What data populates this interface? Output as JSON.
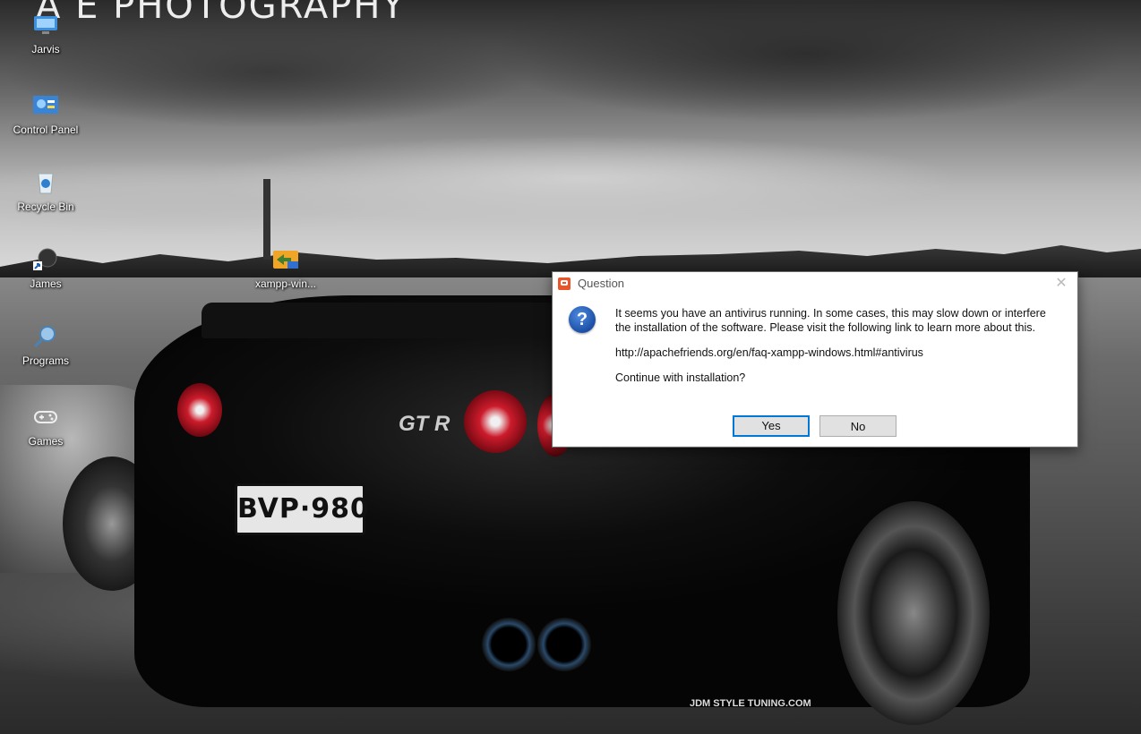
{
  "wallpaper": {
    "brand_text": "A E PHOTOGRAPHY",
    "plate_text": "BVP·980",
    "badge_text": "GT R",
    "footer_text": "JDM STYLE TUNING.COM"
  },
  "desktop": {
    "icons": [
      {
        "label": "Jarvis",
        "icon": "user-folder-icon"
      },
      {
        "label": "Control Panel",
        "icon": "control-panel-icon"
      },
      {
        "label": "Recycle Bin",
        "icon": "recycle-bin-icon"
      },
      {
        "label": "James",
        "icon": "shortcut-icon"
      },
      {
        "label": "Programs",
        "icon": "search-icon"
      },
      {
        "label": "Games",
        "icon": "gamepad-icon"
      },
      {
        "label": "xampp-win...",
        "icon": "xampp-installer-icon"
      }
    ]
  },
  "dialog": {
    "title": "Question",
    "close_glyph": "✕",
    "question_glyph": "?",
    "message_line1": "It seems you have an antivirus running. In some cases, this may slow down or interfere the installation of the software. Please visit the following link to learn more about this.",
    "link": "http://apachefriends.org/en/faq-xampp-windows.html#antivirus",
    "prompt": "Continue with installation?",
    "yes_label": "Yes",
    "no_label": "No",
    "accent_color": "#0078d7"
  }
}
